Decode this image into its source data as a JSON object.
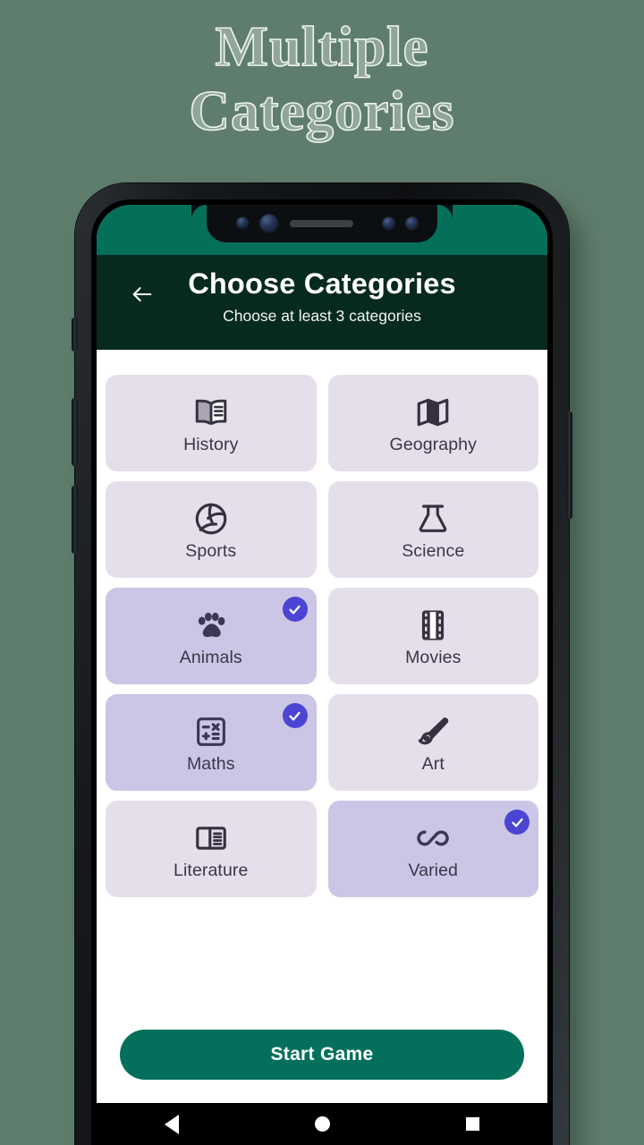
{
  "promo": {
    "line1": "Multiple",
    "line2": "Categories"
  },
  "colors": {
    "page_background": "#5f7d6d",
    "status_bar": "#04705a",
    "app_bar": "#072a20",
    "panel": "#ffffff",
    "card_unselected": "#e5dfeb",
    "card_selected": "#cbc6e6",
    "check_badge": "#4b45d4",
    "start_button": "#04705c",
    "label_text": "#3b3646"
  },
  "appbar": {
    "back_icon": "arrow-left-icon",
    "title": "Choose Categories",
    "subtitle": "Choose at least 3 categories"
  },
  "categories": [
    {
      "label": "History",
      "icon": "open-book-icon",
      "selected": false
    },
    {
      "label": "Geography",
      "icon": "map-icon",
      "selected": false
    },
    {
      "label": "Sports",
      "icon": "volleyball-icon",
      "selected": false
    },
    {
      "label": "Science",
      "icon": "flask-icon",
      "selected": false
    },
    {
      "label": "Animals",
      "icon": "paw-icon",
      "selected": true
    },
    {
      "label": "Movies",
      "icon": "film-strip-icon",
      "selected": false
    },
    {
      "label": "Maths",
      "icon": "calculator-icon",
      "selected": true
    },
    {
      "label": "Art",
      "icon": "paintbrush-icon",
      "selected": false
    },
    {
      "label": "Literature",
      "icon": "article-icon",
      "selected": false
    },
    {
      "label": "Varied",
      "icon": "infinity-icon",
      "selected": true
    }
  ],
  "footer": {
    "start_label": "Start Game"
  },
  "navbar": {
    "back": "triangle-back-icon",
    "home": "circle-home-icon",
    "recents": "square-recents-icon"
  }
}
